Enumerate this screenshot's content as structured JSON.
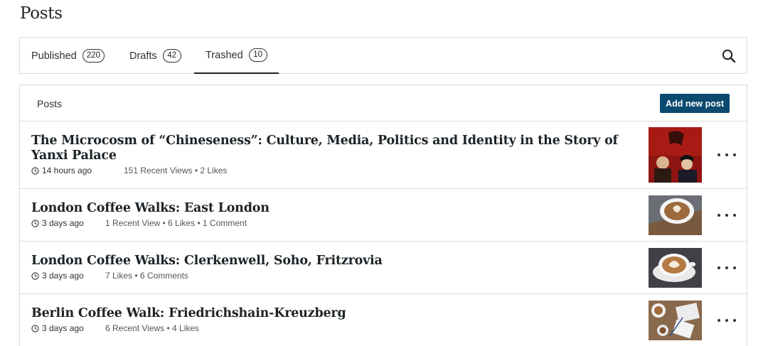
{
  "page": {
    "title": "Posts"
  },
  "tabs": [
    {
      "label": "Published",
      "count": "220"
    },
    {
      "label": "Drafts",
      "count": "42"
    },
    {
      "label": "Trashed",
      "count": "10"
    }
  ],
  "list": {
    "header_label": "Posts",
    "add_button": "Add new post"
  },
  "posts": [
    {
      "title": "The Microcosm of “Chineseness”: Culture, Media, Politics and Identity in the Story of Yanxi Palace",
      "time": "14 hours ago",
      "stats": "151 Recent Views • 2 Likes",
      "thumb_icon": "drama-poster-thumbnail"
    },
    {
      "title": "London Coffee Walks: East London",
      "time": "3 days ago",
      "stats": "1 Recent View • 6 Likes • 1 Comment",
      "thumb_icon": "latte-art-thumbnail"
    },
    {
      "title": "London Coffee Walks: Clerkenwell, Soho, Fritzrovia",
      "time": "3 days ago",
      "stats": "7 Likes • 6 Comments",
      "thumb_icon": "latte-cup-thumbnail"
    },
    {
      "title": "Berlin Coffee Walk: Friedrichshain-Kreuzberg",
      "time": "3 days ago",
      "stats": "6 Recent Views • 4 Likes",
      "thumb_icon": "coffee-table-thumbnail"
    }
  ]
}
